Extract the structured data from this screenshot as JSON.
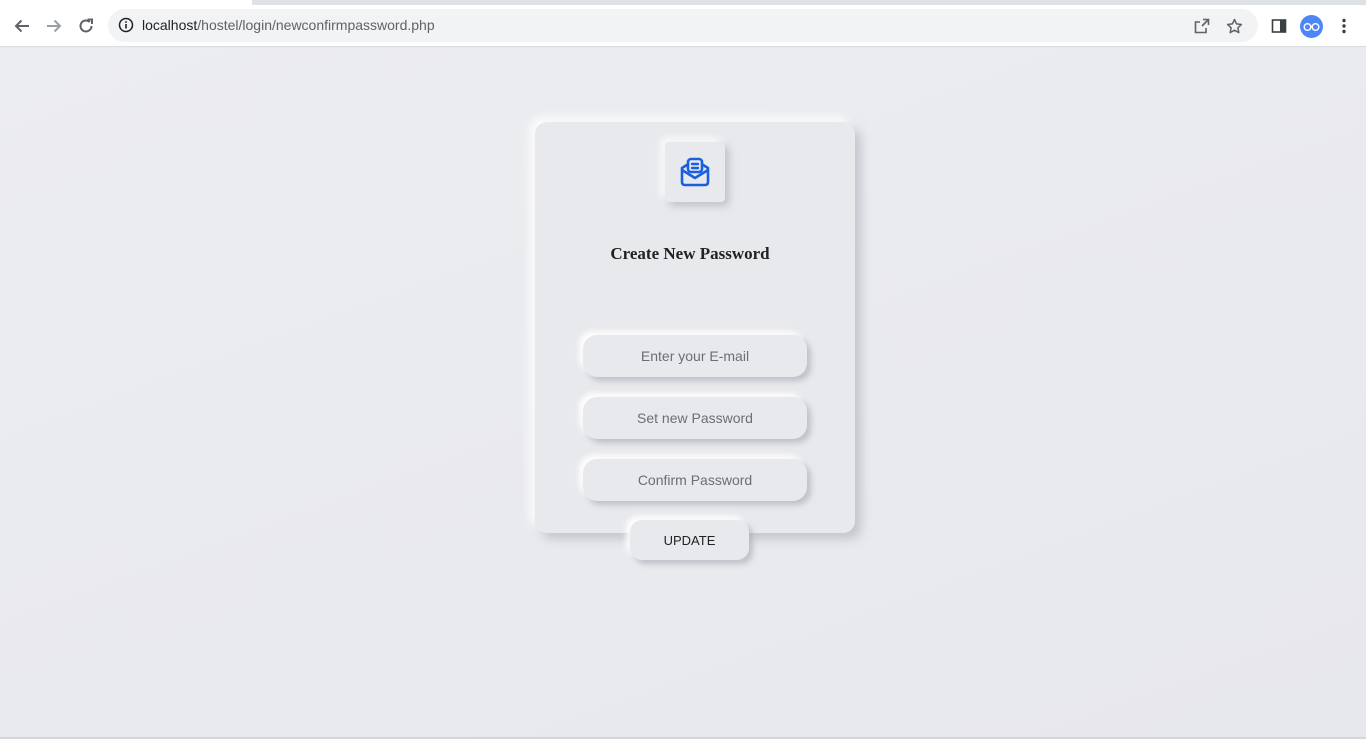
{
  "browser": {
    "url_host": "localhost",
    "url_path": "/hostel/login/newconfirmpassword.php",
    "accent": "#1a73e8"
  },
  "form": {
    "title": "Create New Password",
    "email_placeholder": "Enter your E-mail",
    "new_password_placeholder": "Set new Password",
    "confirm_password_placeholder": "Confirm Password",
    "update_label": "UPDATE",
    "logo_icon": "mail-open-icon",
    "logo_color": "#1a5fe0"
  }
}
